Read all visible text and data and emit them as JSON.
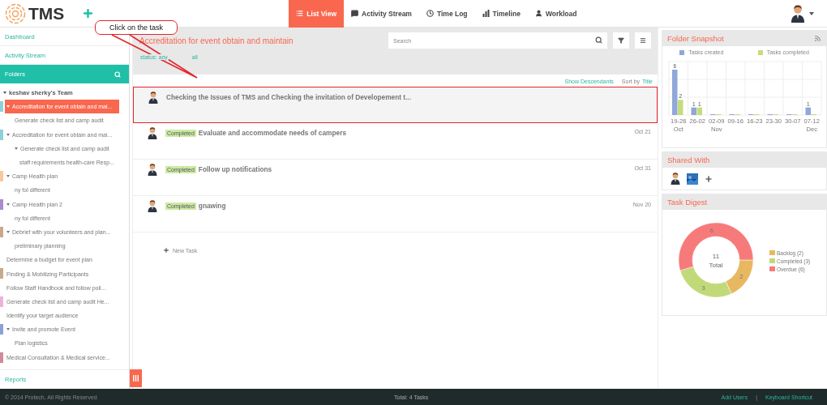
{
  "brand": "TMS",
  "nav": [
    {
      "label": "List View",
      "selected": true
    },
    {
      "label": "Activity Stream",
      "selected": false
    },
    {
      "label": "Time Log",
      "selected": false
    },
    {
      "label": "Timeline",
      "selected": false
    },
    {
      "label": "Workload",
      "selected": false
    }
  ],
  "callout": "Click on the task",
  "sidebar": {
    "links": [
      "Dashboard",
      "Activity Stream"
    ],
    "folders_header": "Folders",
    "tree": {
      "label": "keshav sherky's Team",
      "expanded": true,
      "children": [
        {
          "label": "Accreditation for event obtain and mai...",
          "selected": true,
          "expanded": true,
          "color": "#8fd0d8",
          "children": [
            {
              "label": "Generate check list and camp audit",
              "selected": false
            }
          ]
        },
        {
          "label": "Accreditation for event obtain and mai...",
          "selected": false,
          "expanded": true,
          "color": "#8fd0d8",
          "children": [
            {
              "label": "Generate check list and camp audit",
              "selected": false,
              "expanded": true,
              "children": [
                {
                  "label": "staff requirements health-care Resp...",
                  "selected": false
                }
              ]
            }
          ]
        },
        {
          "label": "Camp Health plan",
          "selected": false,
          "expanded": true,
          "color": "#f9c99b",
          "children": [
            {
              "label": "ny fol different",
              "selected": false
            }
          ]
        },
        {
          "label": "Camp Health plan 2",
          "selected": false,
          "expanded": true,
          "color": "#a98bd0",
          "children": [
            {
              "label": "ny fol different",
              "selected": false
            }
          ]
        },
        {
          "label": "Debrief with your volunteers and plan...",
          "selected": false,
          "expanded": true,
          "color": "#c9a98a",
          "children": [
            {
              "label": "preliminary planning",
              "selected": false
            }
          ]
        },
        {
          "label": "Determine a budget for event plan",
          "selected": false
        },
        {
          "label": "Finding & Mobilizing Participants",
          "selected": false,
          "color": "#c9a98a"
        },
        {
          "label": "Follow Staff Handbook and follow poli...",
          "selected": false
        },
        {
          "label": "Generate check list and camp audit He...",
          "selected": false,
          "color": "#f0b0dc"
        },
        {
          "label": "Identify your target audience",
          "selected": false
        },
        {
          "label": "Invite and promote Event",
          "selected": false,
          "expanded": true,
          "color": "#8aa0d8",
          "children": [
            {
              "label": "Plan logistics",
              "selected": false
            }
          ]
        },
        {
          "label": "Medical Consultation & Medical service...",
          "selected": false,
          "color": "#d08a9a"
        }
      ]
    },
    "reports": "Reports"
  },
  "main": {
    "title": "Accreditation for event obtain and maintain",
    "search": {
      "placeholder": "Search"
    },
    "status_filter": "status: any",
    "status_all": "all",
    "show_descendants": "Show Descendants",
    "sort_label": "Sort by",
    "sort_value": "Title",
    "tasks": [
      {
        "title": "Checking the Issues of TMS and Checking the invitation of Developement t...",
        "highlighted": true
      },
      {
        "status": "Completed",
        "title": "Evaluate and accommodate needs of campers",
        "date": "Oct 21",
        "highlighted": false
      },
      {
        "status": "Completed",
        "title": "Follow up notifications",
        "date": "Oct 31",
        "highlighted": false
      },
      {
        "status": "Completed",
        "title": "gnawing",
        "date": "Nov 20",
        "highlighted": false
      }
    ],
    "new_task": "New Task"
  },
  "folder_snapshot": {
    "title": "Folder Snapshot",
    "chart_data": {
      "type": "bar",
      "categories": [
        "19-26\nOct",
        "26-02",
        "02-09\nNov",
        "09-16",
        "16-23",
        "23-30",
        "30-07",
        "07-12\nDec"
      ],
      "series": [
        {
          "name": "Tasks created",
          "color": "#8fa8d8",
          "values": [
            6,
            1,
            null,
            null,
            null,
            null,
            null,
            1
          ]
        },
        {
          "name": "Tasks completed",
          "color": "#c5dd7a",
          "values": [
            2,
            1,
            null,
            null,
            null,
            null,
            null,
            null
          ]
        }
      ],
      "data_labels": true
    }
  },
  "shared_with": {
    "title": "Shared With"
  },
  "task_digest": {
    "title": "Task Digest",
    "chart_data": {
      "type": "donut",
      "categories": [
        "Backlog (2)",
        "Completed (3)",
        "Overdue (6)"
      ],
      "values": [
        2,
        3,
        6
      ],
      "colors": [
        "#e8b860",
        "#c2d97a",
        "#f77a7a"
      ],
      "data_labels": true
    },
    "center_value": "11",
    "center_label": "Total"
  },
  "footer": {
    "copyright": "© 2014 Protech, All Rights Reserved",
    "total": "Total: 4 Tasks",
    "links": [
      "Add Users",
      "Keyboard Shortcut"
    ],
    "separator": "|"
  }
}
